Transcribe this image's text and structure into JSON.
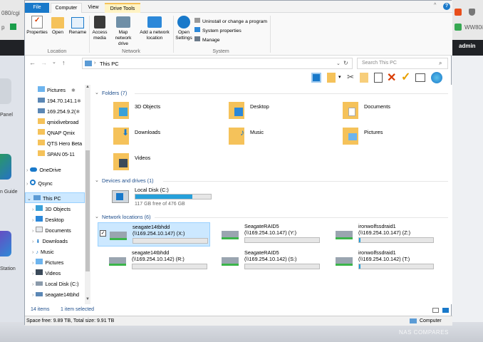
{
  "browser": {
    "url_fragment": "080/cgi",
    "tab_fav_left": "p",
    "bookmark_right": "WW80i",
    "admin_label": "admin"
  },
  "desktop": {
    "left_labels": [
      "Panel",
      "n Guide",
      "Station"
    ],
    "watermark": "NAS COMPARES"
  },
  "ribbon": {
    "tabs": [
      "File",
      "Computer",
      "View",
      "Drive Tools"
    ],
    "buttons": {
      "properties": "Properties",
      "open": "Open",
      "rename": "Rename",
      "access_media": "Access media",
      "map_network": "Map network drive",
      "add_network": "Add a network location",
      "open_settings": "Open Settings",
      "uninstall": "Uninstall or change a program",
      "system_props": "System properties",
      "manage": "Manage"
    },
    "groups": {
      "location": "Location",
      "network": "Network",
      "system": "System"
    }
  },
  "address": {
    "path": "This PC",
    "search_placeholder": "Search This PC"
  },
  "nav": {
    "items": [
      {
        "label": "Pictures",
        "pin": "✱",
        "icon": "folder-picture-icon"
      },
      {
        "label": "194.70.141.1",
        "pin": "✱",
        "icon": "network-drive-icon"
      },
      {
        "label": "169.254.9.2(",
        "pin": "✱",
        "icon": "network-drive-icon"
      },
      {
        "label": "qmixlivebroad",
        "pin": "",
        "icon": "folder-icon"
      },
      {
        "label": "QNAP Qmix",
        "pin": "",
        "icon": "folder-icon"
      },
      {
        "label": "QTS Hero Beta",
        "pin": "",
        "icon": "folder-icon"
      },
      {
        "label": "SPAN 05-11",
        "pin": "",
        "icon": "folder-icon"
      },
      {
        "label": "OneDrive",
        "pin": "",
        "icon": "cloud-icon"
      },
      {
        "label": "Qsync",
        "pin": "",
        "icon": "qsync-icon"
      },
      {
        "label": "This PC",
        "pin": "",
        "icon": "computer-icon"
      },
      {
        "label": "3D Objects",
        "pin": "",
        "icon": "folder-3d-icon"
      },
      {
        "label": "Desktop",
        "pin": "",
        "icon": "folder-desktop-icon"
      },
      {
        "label": "Documents",
        "pin": "",
        "icon": "folder-docs-icon"
      },
      {
        "label": "Downloads",
        "pin": "",
        "icon": "folder-down-icon"
      },
      {
        "label": "Music",
        "pin": "",
        "icon": "music-icon"
      },
      {
        "label": "Pictures",
        "pin": "",
        "icon": "folder-picture-icon"
      },
      {
        "label": "Videos",
        "pin": "",
        "icon": "folder-video-icon"
      },
      {
        "label": "Local Disk (C:)",
        "pin": "",
        "icon": "drive-icon"
      },
      {
        "label": "seagate14tbhd",
        "pin": "",
        "icon": "network-drive-icon"
      }
    ]
  },
  "groups": {
    "folders": {
      "title": "Folders (7)",
      "items": [
        "3D Objects",
        "Desktop",
        "Documents",
        "Downloads",
        "Music",
        "Pictures",
        "Videos"
      ]
    },
    "drives": {
      "title": "Devices and drives (1)",
      "items": [
        {
          "name": "Local Disk (C:)",
          "free": "117 GB free of 476 GB",
          "used_fraction": 0.75
        }
      ]
    },
    "network": {
      "title": "Network locations (6)",
      "items": [
        {
          "name": "seagate14tbhdd",
          "path": "(\\\\169.254.10.147) (X:)",
          "used_fraction": 0.0,
          "selected": true
        },
        {
          "name": "SeagateRAID5",
          "path": "(\\\\169.254.10.147) (Y:)",
          "used_fraction": 0.0
        },
        {
          "name": "ironwolfssdraid1",
          "path": "(\\\\169.254.10.147) (Z:)",
          "used_fraction": 0.02
        },
        {
          "name": "seagate14tbhdd",
          "path": "(\\\\169.254.10.142) (R:)",
          "used_fraction": 0.0
        },
        {
          "name": "SeagateRAID5",
          "path": "(\\\\169.254.10.142) (S:)",
          "used_fraction": 0.0
        },
        {
          "name": "ironwolfssdraid1",
          "path": "(\\\\169.254.10.142) (T:)",
          "used_fraction": 0.02
        }
      ]
    }
  },
  "status": {
    "items": "14 items",
    "selected": "1 item selected",
    "space": "Space free: 9.89 TB, Total size: 9.91 TB",
    "location": "Computer"
  },
  "colors": {
    "accent": "#26a0da",
    "folder": "#f5c25a",
    "close_x": "#d83b01",
    "check": "#e8a000"
  }
}
